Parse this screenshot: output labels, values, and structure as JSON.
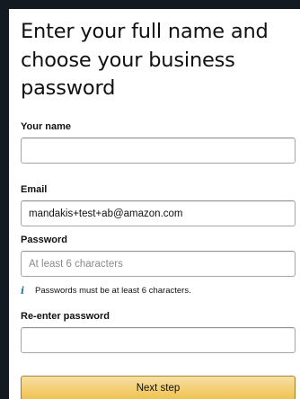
{
  "page": {
    "title": "Enter your full name and choose your business password"
  },
  "form": {
    "name": {
      "label": "Your name",
      "value": "",
      "placeholder": ""
    },
    "email": {
      "label": "Email",
      "value": "mandakis+test+ab@amazon.com"
    },
    "password": {
      "label": "Password",
      "value": "",
      "placeholder": "At least 6 characters",
      "hint": "Passwords must be at least 6 characters."
    },
    "reenter_password": {
      "label": "Re-enter password",
      "value": ""
    },
    "submit_label": "Next step"
  },
  "icons": {
    "hint_icon": "info-icon"
  },
  "colors": {
    "background": "#131a22",
    "button_top": "#f7dfa5",
    "button_bottom": "#f0c14b",
    "info_icon": "#2a7a9e"
  }
}
